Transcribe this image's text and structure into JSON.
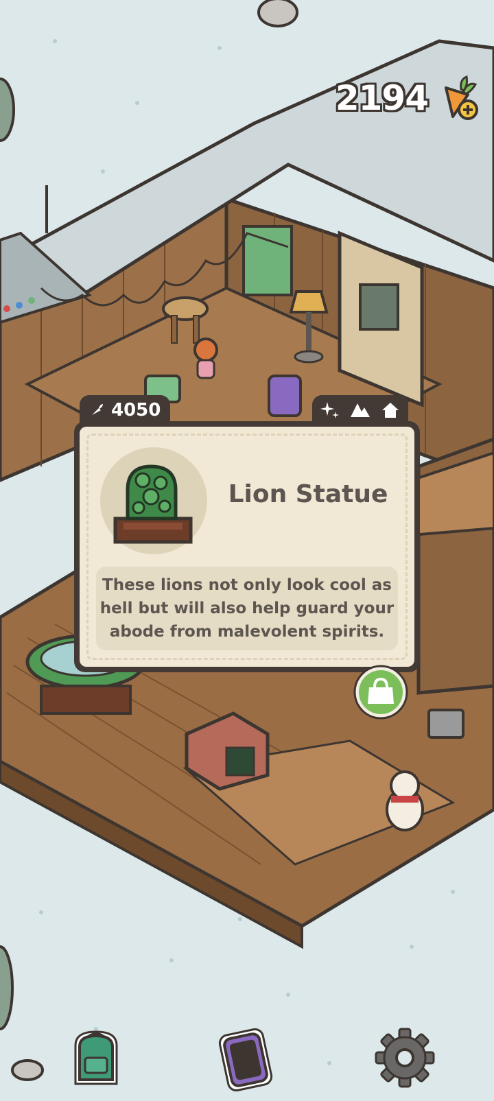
{
  "currency": {
    "amount": "2194",
    "icon": "carrot-plus-icon"
  },
  "item_popup": {
    "price": "4050",
    "price_icon": "carrot-icon",
    "tags": [
      "sparkle-icon",
      "mountains-icon",
      "house-icon"
    ],
    "title": "Lion Statue",
    "description": "These lions not only look cool as hell but will also help guard your abode from malevolent spirits.",
    "image": "jade-lion-statue"
  },
  "shop_button": {
    "icon": "shopping-bag-icon",
    "color": "#7cbf5a"
  },
  "bottom_bar": [
    {
      "name": "backpack-button",
      "icon": "backpack-icon"
    },
    {
      "name": "phone-button",
      "icon": "phone-icon"
    },
    {
      "name": "settings-button",
      "icon": "gear-icon"
    }
  ],
  "colors": {
    "panel_dark": "#433a36",
    "panel_light": "#f1e9d5",
    "snow": "#dde8ea",
    "wood": "#a87a50"
  }
}
